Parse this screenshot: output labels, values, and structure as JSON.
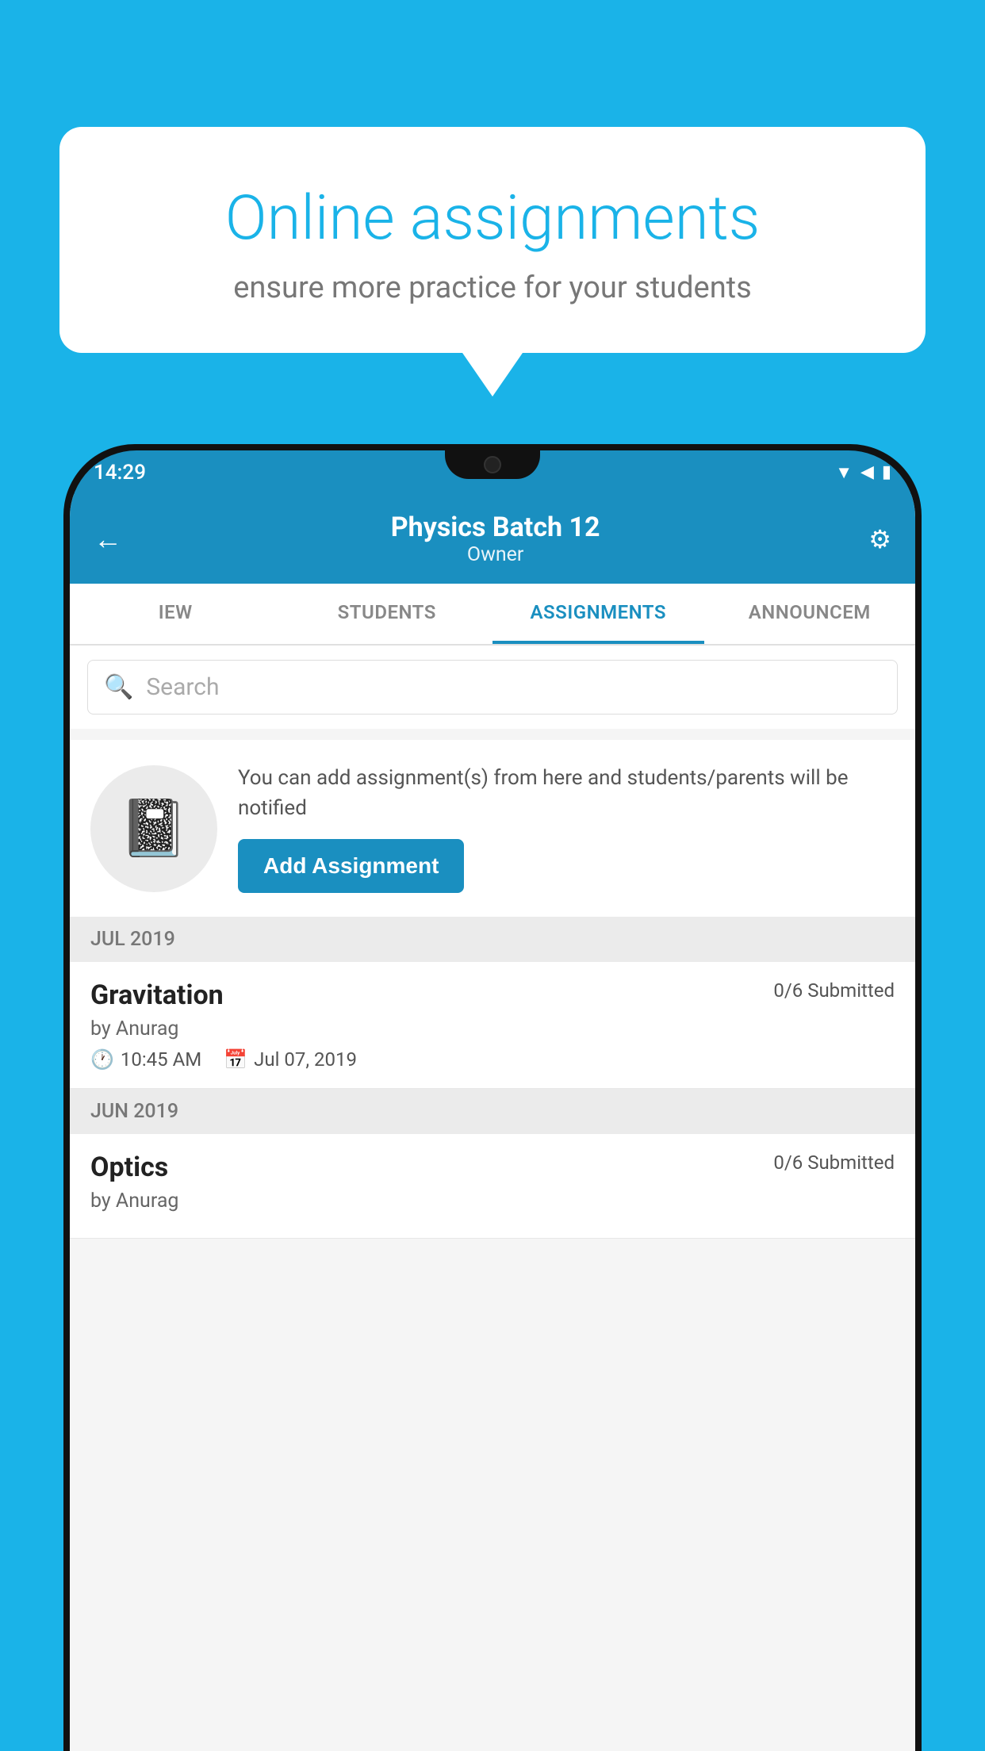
{
  "background_color": "#1ab3e8",
  "speech_bubble": {
    "title": "Online assignments",
    "subtitle": "ensure more practice for your students"
  },
  "status_bar": {
    "time": "14:29",
    "icons": [
      "wifi",
      "signal",
      "battery"
    ]
  },
  "app_bar": {
    "title": "Physics Batch 12",
    "subtitle": "Owner",
    "back_label": "←",
    "settings_label": "⚙"
  },
  "tabs": [
    {
      "label": "IEW",
      "active": false
    },
    {
      "label": "STUDENTS",
      "active": false
    },
    {
      "label": "ASSIGNMENTS",
      "active": true
    },
    {
      "label": "ANNOUNCEM",
      "active": false
    }
  ],
  "search": {
    "placeholder": "Search"
  },
  "promo": {
    "description": "You can add assignment(s) from here and students/parents will be notified",
    "button_label": "Add Assignment"
  },
  "months": [
    {
      "label": "JUL 2019",
      "assignments": [
        {
          "title": "Gravitation",
          "submitted": "0/6 Submitted",
          "author": "by Anurag",
          "time": "10:45 AM",
          "date": "Jul 07, 2019"
        }
      ]
    },
    {
      "label": "JUN 2019",
      "assignments": [
        {
          "title": "Optics",
          "submitted": "0/6 Submitted",
          "author": "by Anurag",
          "time": "",
          "date": ""
        }
      ]
    }
  ]
}
